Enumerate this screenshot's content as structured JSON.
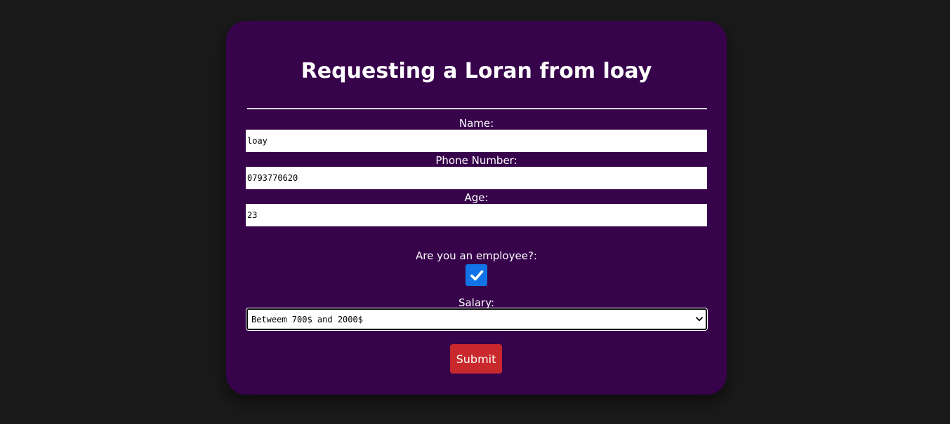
{
  "form": {
    "title": "Requesting a Loran from loay",
    "name_label": "Name:",
    "name_value": "loay",
    "phone_label": "Phone Number:",
    "phone_value": "0793770620",
    "age_label": "Age:",
    "age_value": "23",
    "employee_label": "Are you an employee?:",
    "employee_checked": true,
    "salary_label": "Salary:",
    "salary_selected": "Betweem 700$ and 2000$",
    "submit_label": "Submit"
  },
  "colors": {
    "page_background": "#1b1a1a",
    "card_background": "#37034b",
    "checkbox_accent": "#1273e8",
    "submit_background": "#c9282c"
  },
  "icons": {
    "checkbox": "checkmark-icon",
    "select": "chevron-down-icon"
  }
}
